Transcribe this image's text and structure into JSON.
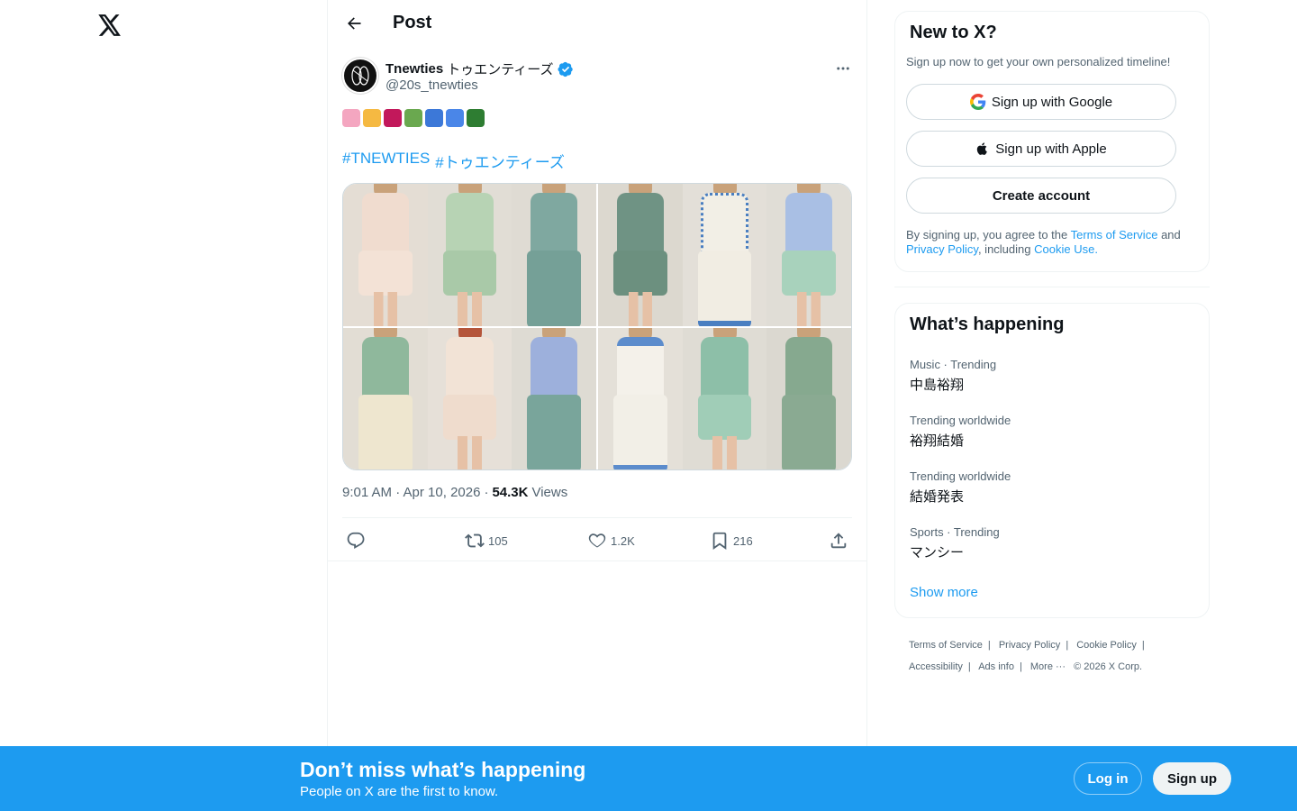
{
  "header": {
    "title": "Post"
  },
  "post": {
    "author_name": "Tnewties",
    "author_name_jp": "トゥエンティーズ",
    "author_handle": "@20s_tnewties",
    "hashtags": [
      "#TNEWTIES",
      "#トゥエンティーズ"
    ],
    "time": "9:01 AM · Apr 10, 2026",
    "views_count": "54.3K",
    "views_label": "Views",
    "retweets": "105",
    "likes": "1.2K",
    "bookmarks": "216",
    "emoji_colors": [
      "#f4a6c0",
      "#f5b942",
      "#c2185b",
      "#6aa84f",
      "#3c78d8",
      "#4a86e8",
      "#2e7d32"
    ]
  },
  "signup": {
    "title": "New to X?",
    "subtitle": "Sign up now to get your own personalized timeline!",
    "google_label": "Sign up with Google",
    "apple_label": "Sign up with Apple",
    "create_label": "Create account",
    "legal_prefix": "By signing up, you agree to the",
    "terms": "Terms of Service",
    "and": "and",
    "privacy": "Privacy Policy",
    "including": ", including",
    "cookie": "Cookie Use."
  },
  "trends": {
    "title": "What’s happening",
    "items": [
      {
        "context": "Music · Trending",
        "name": "中島裕翔"
      },
      {
        "context": "Trending worldwide",
        "name": "裕翔結婚"
      },
      {
        "context": "Trending worldwide",
        "name": "結婚発表"
      },
      {
        "context": "Sports · Trending",
        "name": "マンシー"
      }
    ],
    "show_more": "Show more"
  },
  "footer": {
    "links": [
      "Terms of Service",
      "Privacy Policy",
      "Cookie Policy",
      "Accessibility",
      "Ads info",
      "More ···",
      "© 2026 X Corp."
    ]
  },
  "banner": {
    "title": "Don’t miss what’s happening",
    "subtitle": "People on X are the first to know.",
    "login": "Log in",
    "signup": "Sign up"
  },
  "colors": {
    "accent": "#1d9bf0",
    "text": "#0f1419",
    "muted": "#536471"
  }
}
